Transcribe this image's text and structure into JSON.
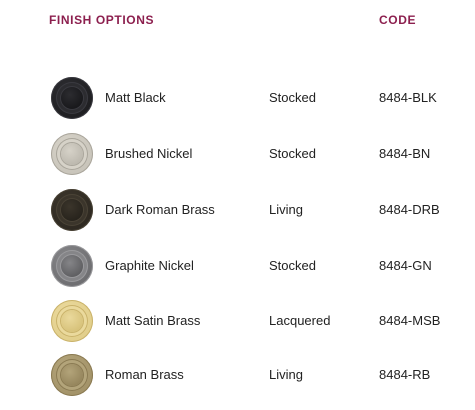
{
  "header": {
    "finish_options": "FINISH OPTIONS",
    "code": "CODE"
  },
  "accent_color": "#8c1f4e",
  "finishes": [
    {
      "name": "Matt Black",
      "status": "Stocked",
      "code": "8484-BLK",
      "colors": {
        "outer": "#1f1f22",
        "rim": "#2c2c30",
        "face": "#18181b",
        "edge": "#3a3a40"
      }
    },
    {
      "name": "Brushed Nickel",
      "status": "Stocked",
      "code": "8484-BN",
      "colors": {
        "outer": "#c9c5bb",
        "rim": "#d6d2c8",
        "face": "#bcb8ae",
        "edge": "#a9a59b"
      }
    },
    {
      "name": "Dark Roman Brass",
      "status": "Living",
      "code": "8484-DRB",
      "colors": {
        "outer": "#2f2a22",
        "rim": "#3b352b",
        "face": "#27231c",
        "edge": "#4a4336"
      }
    },
    {
      "name": "Graphite Nickel",
      "status": "Stocked",
      "code": "8484-GN",
      "colors": {
        "outer": "#6f6f72",
        "rim": "#858588",
        "face": "#5e5e61",
        "edge": "#9a9a9d"
      }
    },
    {
      "name": "Matt Satin Brass",
      "status": "Lacquered",
      "code": "8484-MSB",
      "colors": {
        "outer": "#e2cf8c",
        "rim": "#ead99c",
        "face": "#d7c27a",
        "edge": "#c9b26a"
      }
    },
    {
      "name": "Roman Brass",
      "status": "Living",
      "code": "8484-RB",
      "colors": {
        "outer": "#a4946a",
        "rim": "#b3a47a",
        "face": "#95855c",
        "edge": "#8a7a52"
      }
    }
  ]
}
